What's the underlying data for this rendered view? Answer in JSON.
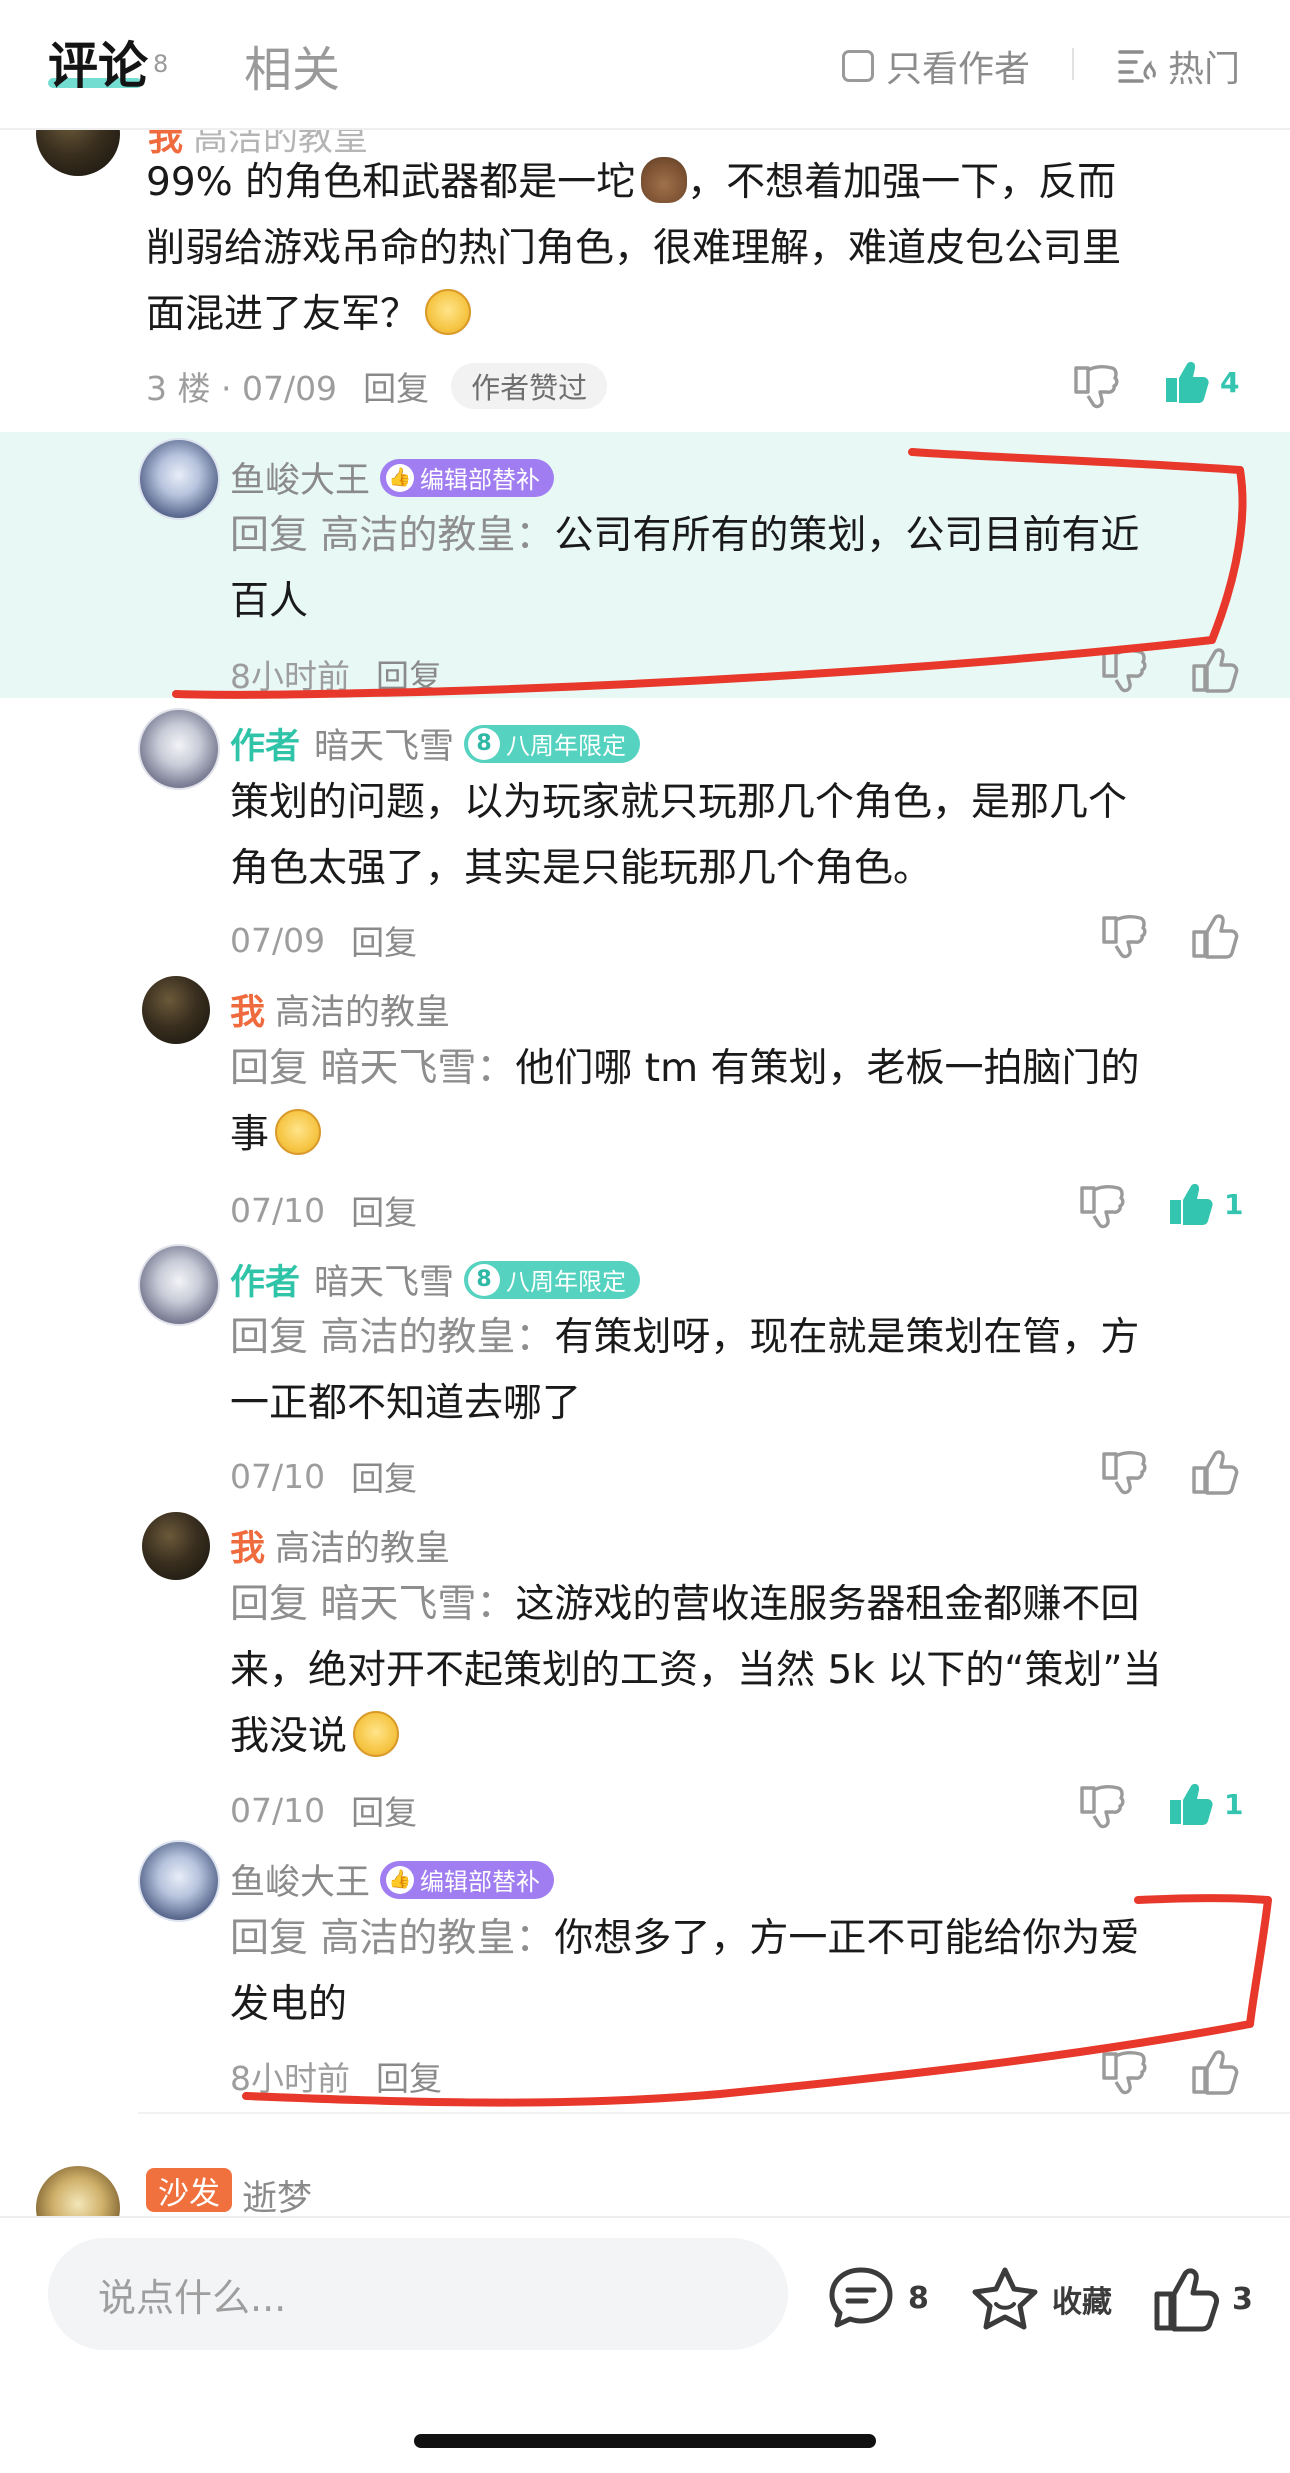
{
  "tabs": {
    "active_label": "评论",
    "count": "8",
    "related_label": "相关"
  },
  "filters": {
    "only_author": "只看作者",
    "sort_label": "热门"
  },
  "comment_top": {
    "name_partial": "高洁的教皇",
    "text_line1": "99% 的角色和武器都是一坨",
    "text_line1b": "，不想着加强一下，反而",
    "text_line2": "削弱给游戏吊命的热门角色，很难理解，难道皮包公司里",
    "text_line3": "面混进了友军？",
    "floor_date": "3 楼 · 07/09",
    "reply": "回复",
    "author_liked": "作者赞过",
    "likes": "4"
  },
  "replies": [
    {
      "name": "鱼峻大王",
      "badge": "编辑部替补",
      "reply_prefix": "回复 高洁的教皇：",
      "line1": "公司有所有的策划，公司目前有近",
      "line2": "百人",
      "time": "8小时前",
      "reply": "回复"
    },
    {
      "author_tag": "作者",
      "name": "暗天飞雪",
      "badge": "八周年限定",
      "line1": "策划的问题，以为玩家就只玩那几个角色，是那几个",
      "line2": "角色太强了，其实是只能玩那几个角色。",
      "time": "07/09",
      "reply": "回复"
    },
    {
      "me_tag": "我",
      "name": "高洁的教皇",
      "reply_prefix": "回复 暗天飞雪：",
      "line1": "他们哪 tm 有策划，老板一拍脑门的",
      "line2": "事",
      "time": "07/10",
      "reply": "回复",
      "likes": "1"
    },
    {
      "author_tag": "作者",
      "name": "暗天飞雪",
      "badge": "八周年限定",
      "reply_prefix": "回复 高洁的教皇：",
      "line1": "有策划呀，现在就是策划在管，方",
      "line2": "一正都不知道去哪了",
      "time": "07/10",
      "reply": "回复"
    },
    {
      "me_tag": "我",
      "name": "高洁的教皇",
      "reply_prefix": "回复 暗天飞雪：",
      "line1": "这游戏的营收连服务器租金都赚不回",
      "line2": "来，绝对开不起策划的工资，当然 5k 以下的“策划”当",
      "line3": "我没说",
      "time": "07/10",
      "reply": "回复",
      "likes": "1"
    },
    {
      "name": "鱼峻大王",
      "badge": "编辑部替补",
      "reply_prefix": "回复 高洁的教皇：",
      "line1": "你想多了，方一正不可能给你为爱",
      "line2": "发电的",
      "time": "8小时前",
      "reply": "回复"
    }
  ],
  "next_comment": {
    "sofa_badge": "沙发",
    "name": "逝梦"
  },
  "bottom": {
    "input_placeholder": "说点什么...",
    "comment_count": "8",
    "favorite_label": "收藏",
    "like_count": "3"
  },
  "colors": {
    "accent": "#34c5b1",
    "me": "#ef6b3d",
    "edit_badge": "#a07ef2",
    "highlight": "#e8f8f5",
    "annotation": "#e8382b"
  }
}
